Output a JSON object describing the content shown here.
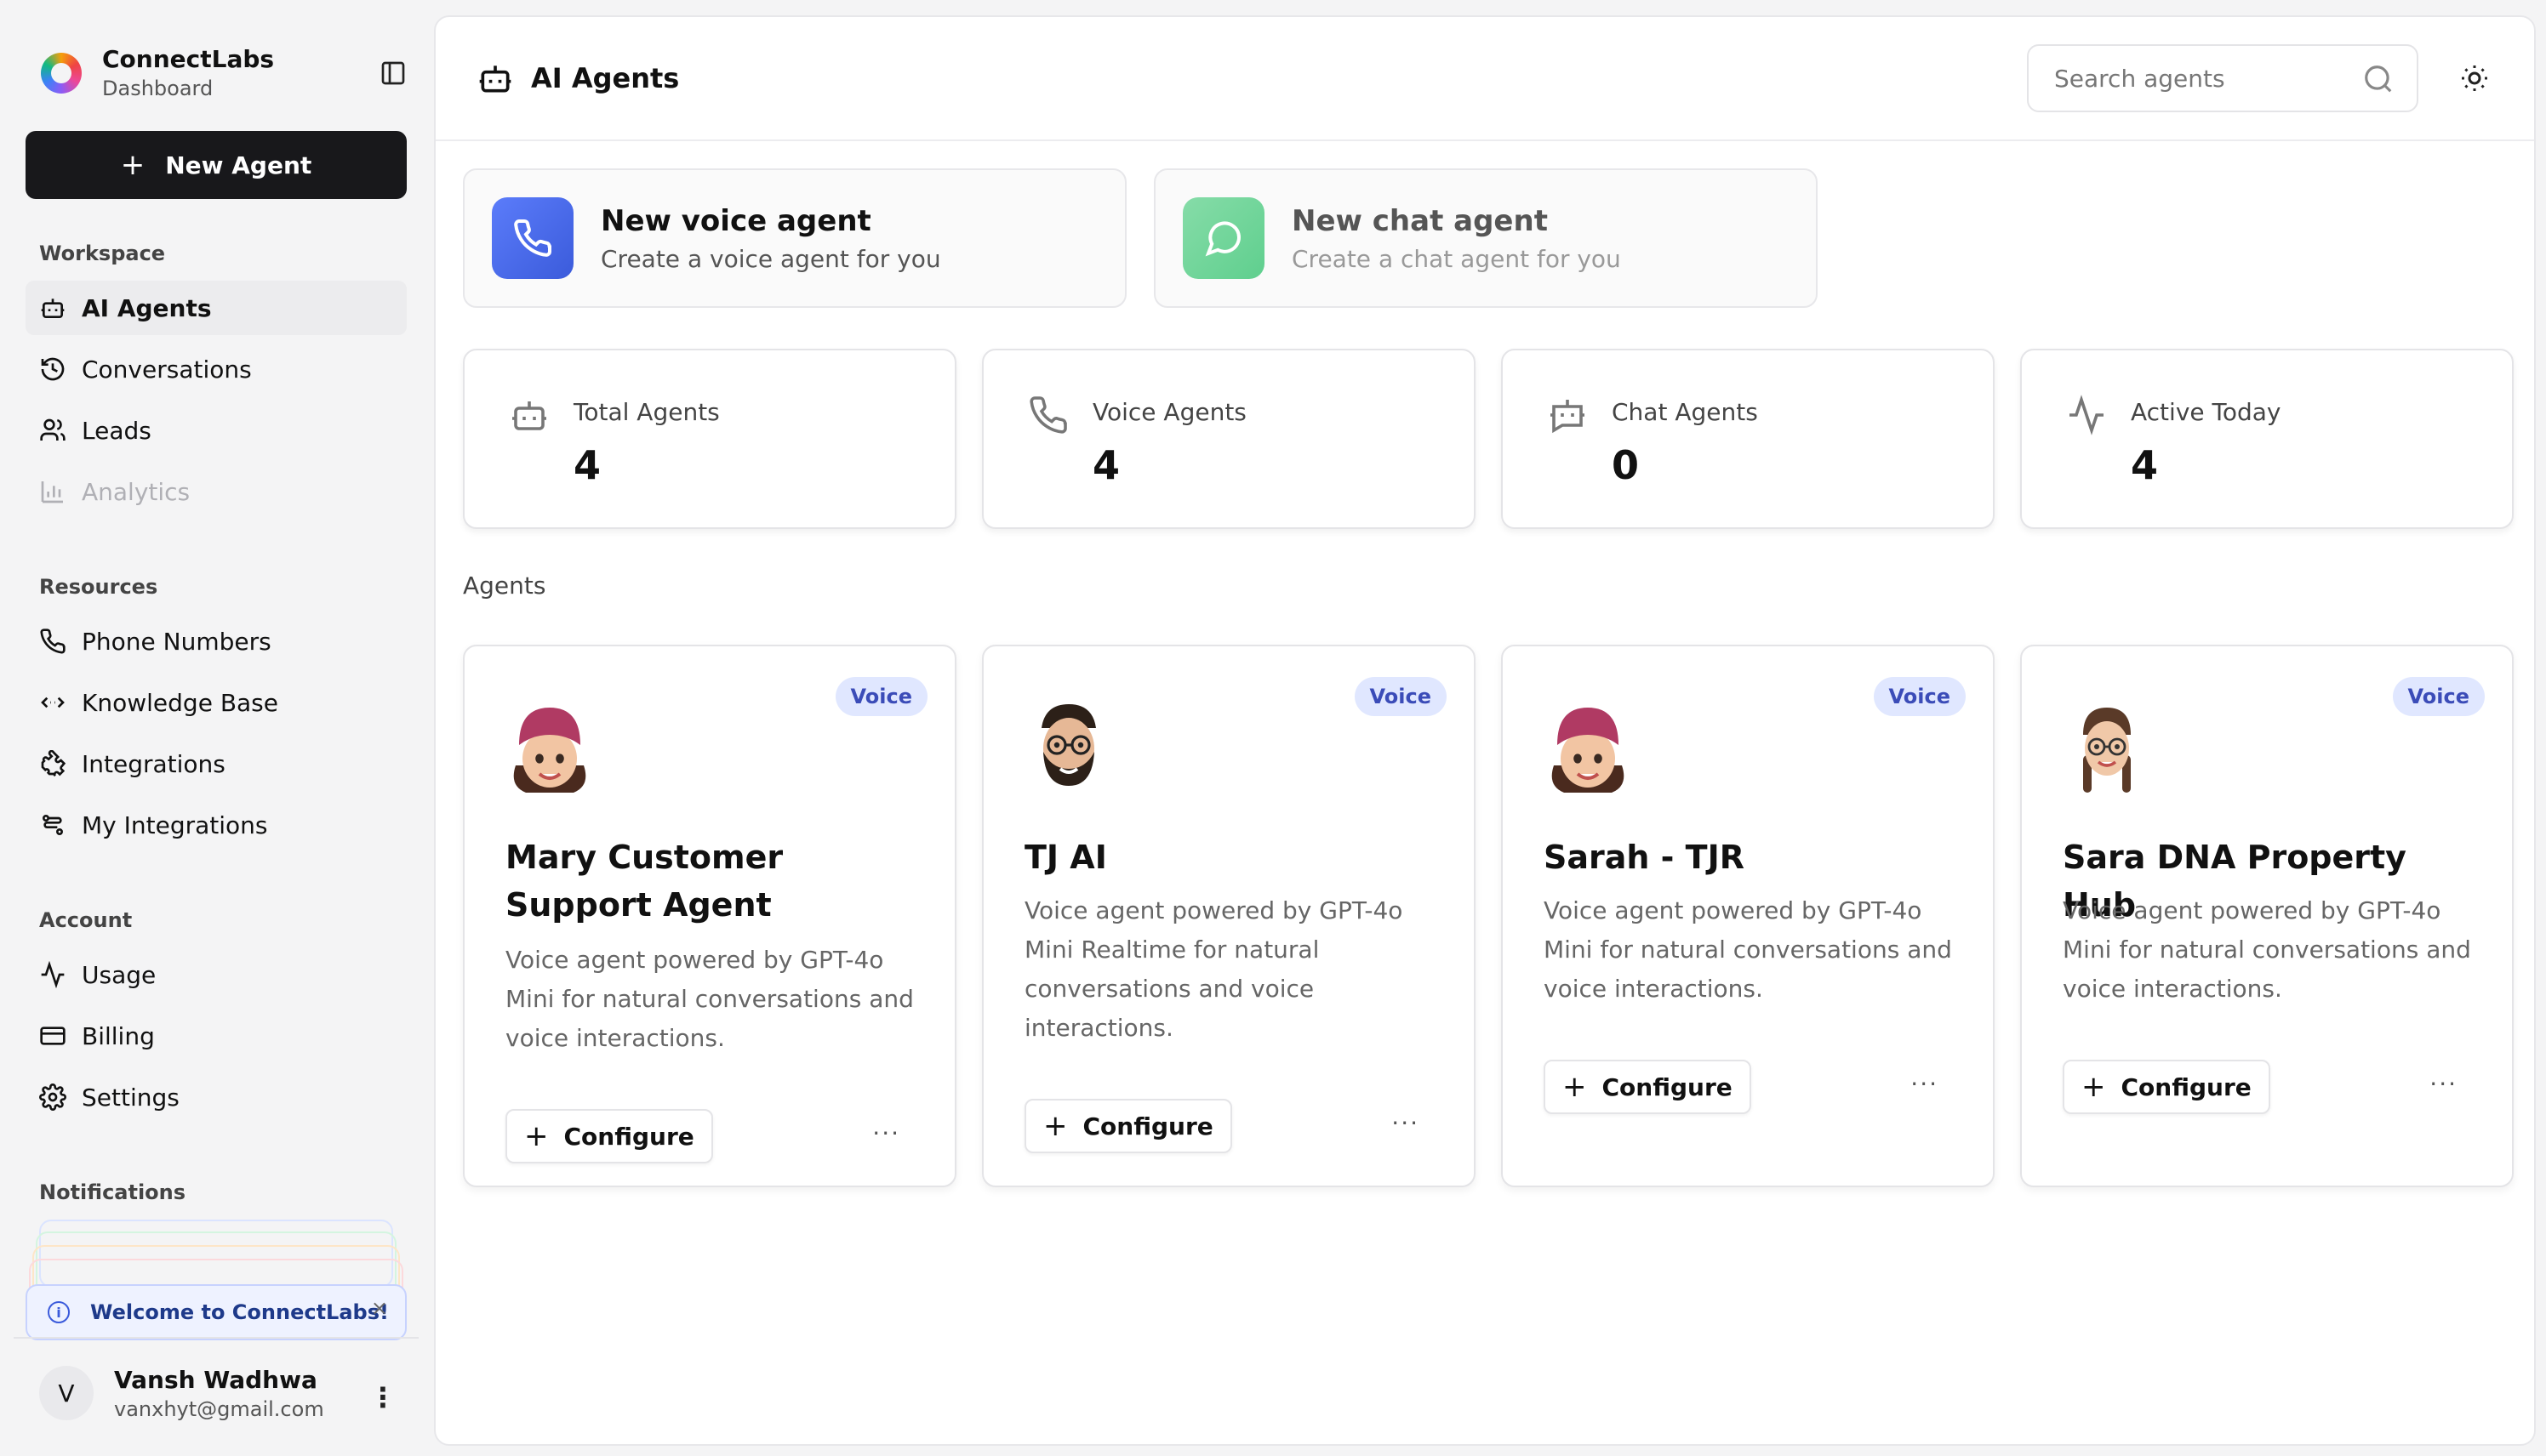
{
  "brand": {
    "title": "ConnectLabs",
    "subtitle": "Dashboard"
  },
  "sidebar": {
    "new_agent_label": "New Agent",
    "workspace_label": "Workspace",
    "workspace_items": [
      {
        "label": "AI Agents",
        "icon": "bot-icon",
        "active": true
      },
      {
        "label": "Conversations",
        "icon": "history-icon"
      },
      {
        "label": "Leads",
        "icon": "users-icon"
      },
      {
        "label": "Analytics",
        "icon": "bar-chart-icon",
        "disabled": true
      }
    ],
    "resources_label": "Resources",
    "resources_items": [
      {
        "label": "Phone Numbers",
        "icon": "phone-icon"
      },
      {
        "label": "Knowledge Base",
        "icon": "code-brackets-icon"
      },
      {
        "label": "Integrations",
        "icon": "puzzle-icon"
      },
      {
        "label": "My Integrations",
        "icon": "workflow-icon"
      }
    ],
    "account_label": "Account",
    "account_items": [
      {
        "label": "Usage",
        "icon": "activity-icon"
      },
      {
        "label": "Billing",
        "icon": "credit-card-icon"
      },
      {
        "label": "Settings",
        "icon": "gear-icon"
      }
    ],
    "notifications_label": "Notifications",
    "notification_text": "Welcome to ConnectLabs!",
    "user": {
      "initial": "V",
      "name": "Vansh Wadhwa",
      "email": "vanxhyt@gmail.com"
    }
  },
  "header": {
    "title": "AI Agents",
    "search_placeholder": "Search agents"
  },
  "create_cards": [
    {
      "title": "New voice agent",
      "subtitle": "Create a voice agent for you",
      "color": "#4f6ef7"
    },
    {
      "title": "New chat agent",
      "subtitle": "Create a chat agent for you",
      "color": "#5fcf8e"
    }
  ],
  "stats": [
    {
      "label": "Total Agents",
      "value": "4",
      "icon": "bot-icon"
    },
    {
      "label": "Voice Agents",
      "value": "4",
      "icon": "phone-icon"
    },
    {
      "label": "Chat Agents",
      "value": "0",
      "icon": "chat-bot-icon"
    },
    {
      "label": "Active Today",
      "value": "4",
      "icon": "activity-icon"
    }
  ],
  "agents_heading": "Agents",
  "agents": [
    {
      "badge": "Voice",
      "name": "Mary Customer Support Agent",
      "description": "Voice agent powered by GPT-4o Mini for natural conversations and voice interactions.",
      "configure_label": "Configure",
      "avatar": "woman-beanie-memoji"
    },
    {
      "badge": "Voice",
      "name": "TJ AI",
      "description": "Voice agent powered by GPT-4o Mini Realtime for natural conversations and voice interactions.",
      "configure_label": "Configure",
      "avatar": "man-beard-glasses-memoji"
    },
    {
      "badge": "Voice",
      "name": "Sarah - TJR",
      "description": "Voice agent powered by GPT-4o Mini for natural conversations and voice interactions.",
      "configure_label": "Configure",
      "avatar": "woman-beanie-memoji"
    },
    {
      "badge": "Voice",
      "name": "Sara DNA Property Hub",
      "description": "Voice agent powered by GPT-4o Mini for natural conversations and voice interactions.",
      "configure_label": "Configure",
      "avatar": "woman-braids-glasses-memoji"
    }
  ]
}
